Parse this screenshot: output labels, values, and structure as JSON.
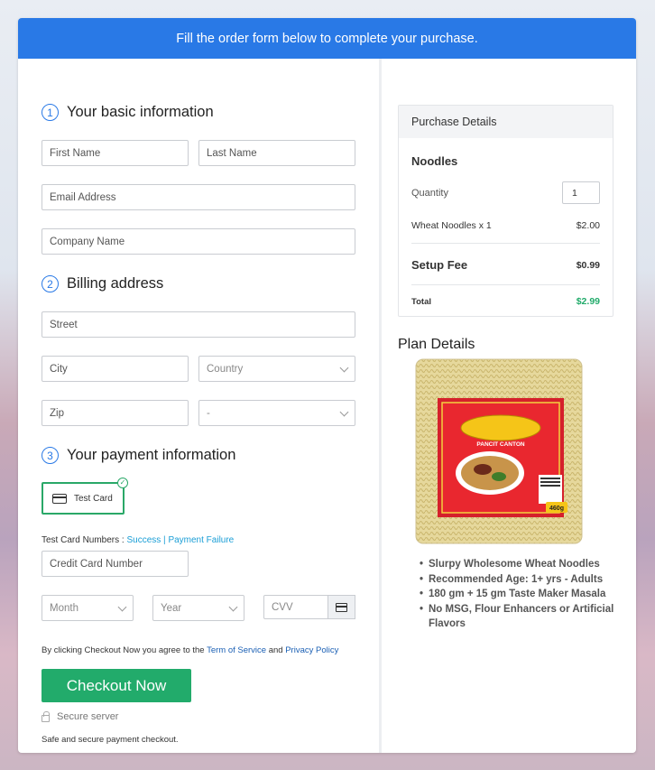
{
  "banner": "Fill the order form below to complete your purchase.",
  "sections": {
    "basic": {
      "num": "1",
      "title": "Your basic information"
    },
    "billing": {
      "num": "2",
      "title": "Billing address"
    },
    "payment": {
      "num": "3",
      "title": "Your payment information"
    }
  },
  "fields": {
    "first_name": "First Name",
    "last_name": "Last Name",
    "email": "Email Address",
    "company": "Company Name",
    "street": "Street",
    "city": "City",
    "country": "Country",
    "zip": "Zip",
    "state": "-",
    "credit_card": "Credit Card Number",
    "month": "Month",
    "year": "Year",
    "cvv": "CVV"
  },
  "payment": {
    "test_card_label": "Test Card",
    "test_numbers_prefix": "Test Card Numbers : ",
    "success": "Success",
    "separator": " | ",
    "failure": "Payment Failure"
  },
  "terms": {
    "prefix": "By clicking Checkout Now you agree to the ",
    "tos": "Term of Service",
    "and": " and ",
    "privacy": "Privacy Policy"
  },
  "checkout_label": "Checkout Now",
  "secure_label": "Secure server",
  "safe_text": "Safe and secure payment checkout.",
  "purchase": {
    "header": "Purchase Details",
    "product": "Noodles",
    "quantity_label": "Quantity",
    "quantity_value": "1",
    "item_label": "Wheat Noodles x 1",
    "item_price": "$2.00",
    "setup_label": "Setup Fee",
    "setup_price": "$0.99",
    "total_label": "Total",
    "total_price": "$2.99"
  },
  "plan": {
    "title": "Plan Details",
    "package_text": "PANCIT CANTON",
    "weight": "460g",
    "bullets": [
      "Slurpy Wholesome Wheat Noodles",
      "Recommended Age: 1+ yrs - Adults",
      "180 gm + 15 gm Taste Maker Masala",
      "No MSG, Flour Enhancers or Artificial",
      "Flavors"
    ]
  },
  "colors": {
    "banner": "#2979e6",
    "accent_green": "#22ab6b",
    "total_green": "#22ab6b",
    "link": "#1a9ed6"
  }
}
